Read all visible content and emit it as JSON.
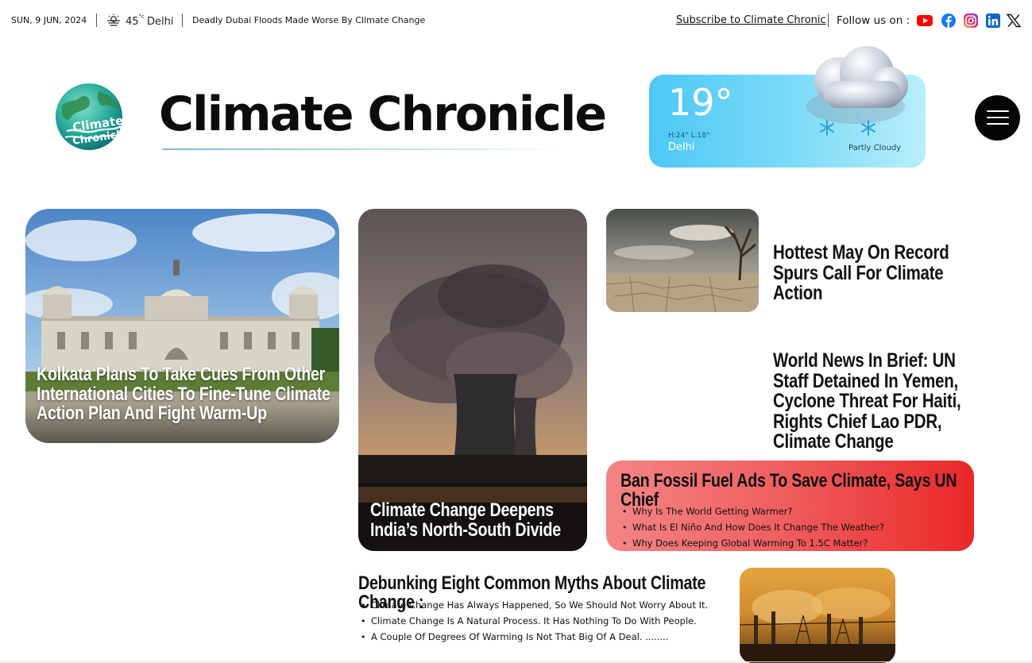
{
  "topbar": {
    "date": "SUN, 9 JUN, 2024",
    "weather_icon": "sun-haze-icon",
    "temperature": "45",
    "temperature_unit": "°c",
    "city": "Delhi",
    "ticker": "Deadly Dubai Floods Made Worse By Climate Change",
    "subscribe_label": "Subscribe to Climate Chronic",
    "follow_label": "Follow us on :",
    "social_icons": [
      "youtube-icon",
      "facebook-icon",
      "instagram-icon",
      "linkedin-icon",
      "x-icon"
    ]
  },
  "header": {
    "logo_text_line1": "Climate",
    "logo_text_line2": "Chronicle",
    "site_title": "Climate Chronicle"
  },
  "weather_card": {
    "temp": "19°",
    "high_low": "H:24°  L:18°",
    "city": "Delhi",
    "condition": "Partly Cloudy",
    "icon": "snow-cloud-icon"
  },
  "articles": {
    "kolkata": "Kolkata Plans To Take Cues From Other International Cities To Fine-Tune Climate Action Plan And Fight Warm-Up",
    "divide": "Climate Change Deepens India’s North-South Divide",
    "hottest_may": "Hottest May On Record Spurs Call For Climate Action",
    "world_news": "World News In Brief: UN Staff Detained In Yemen, Cyclone Threat For Haiti, Rights Chief Lao PDR, Climate Change"
  },
  "fossil_box": {
    "title": "Ban Fossil Fuel Ads To Save Climate, Says UN Chief",
    "items": [
      "Why Is The World Getting Warmer?",
      "What Is El Niño And How Does It Change The Weather?",
      "Why Does Keeping Global Warming To 1.5C Matter?"
    ]
  },
  "myths": {
    "title": "Debunking Eight Common Myths About Climate Change :",
    "items": [
      "Climate Change Has Always Happened, So We Should Not Worry About It.",
      "Climate Change Is A Natural Process. It Has Nothing To Do With People.",
      "A Couple Of Degrees Of Warming Is Not That Big Of A Deal.  ........"
    ]
  },
  "colors": {
    "fossil_box_gradient": [
      "#f48585",
      "#e92828"
    ],
    "weather_card_gradient": [
      "#4cc8f5",
      "#b9eefa"
    ],
    "menu_button": "#050505"
  }
}
